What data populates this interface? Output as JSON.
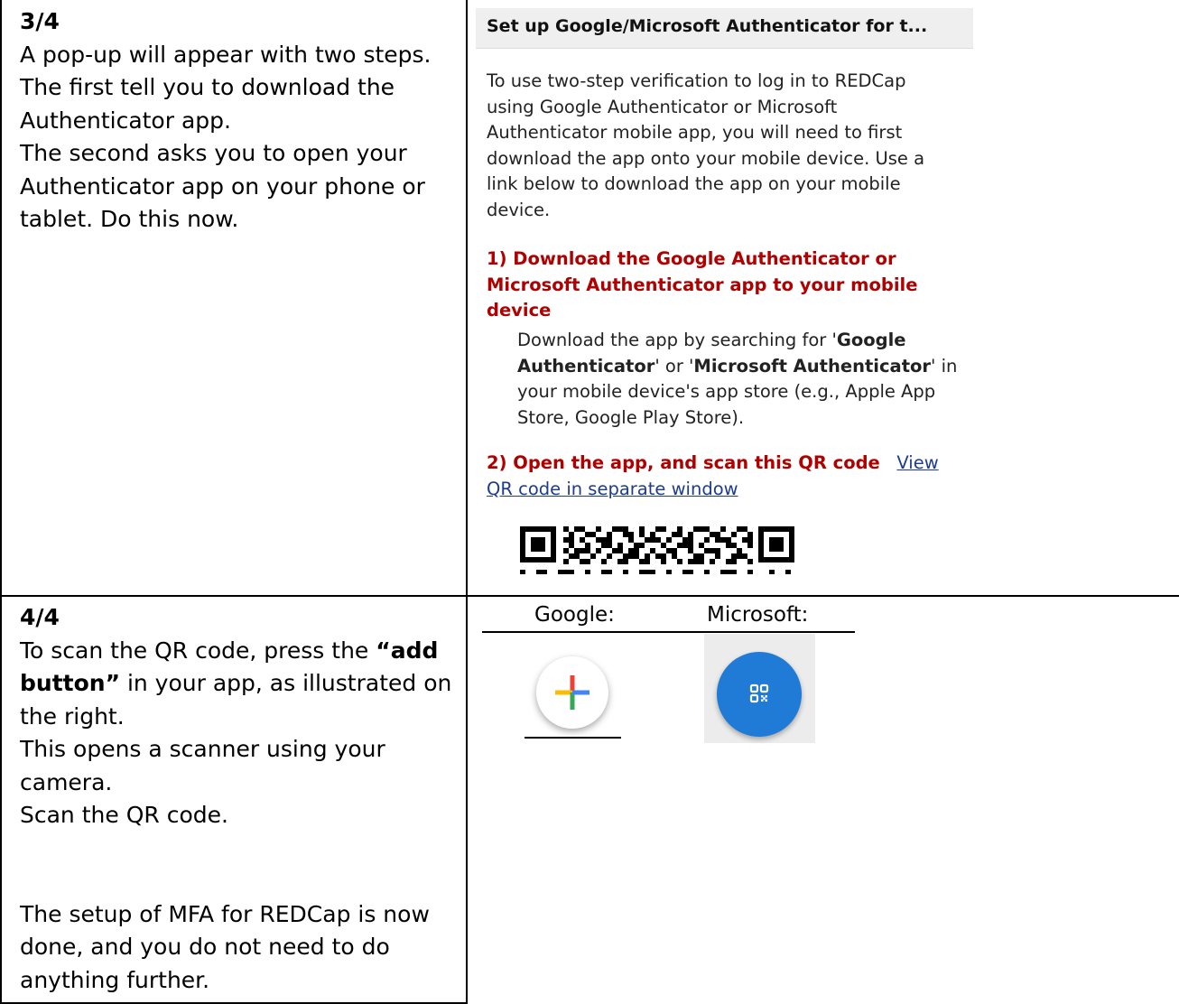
{
  "step3": {
    "label": "3/4",
    "lines": [
      "A pop-up will appear with two steps.",
      "The first tell you to download the",
      "Authenticator app.",
      "The second asks you to open your",
      "Authenticator app on your phone or",
      "tablet. Do this now."
    ]
  },
  "dialog": {
    "title": "Set up Google/Microsoft Authenticator for t...",
    "intro_lines": [
      "To use two-step verification to log in to REDCap",
      "using Google Authenticator or Microsoft",
      "Authenticator mobile app, you will need to first",
      "download the app onto your mobile device. Use a",
      "link below to download the app on your mobile",
      "device."
    ],
    "step1_lines": [
      "1) Download the Google Authenticator or",
      "Microsoft Authenticator app to your mobile",
      "device"
    ],
    "step1_desc": {
      "l1_a": "Download the app by searching for '",
      "l1_b": "Google",
      "l2_a": "Authenticator",
      "l2_b": "' or '",
      "l2_c": "Microsoft Authenticator",
      "l2_d": "' in",
      "l3": "your mobile device's app store (e.g., Apple App",
      "l4": "Store, Google Play Store)."
    },
    "step2_label": "2) Open the app, and scan this QR code",
    "qr_link_1": "View",
    "qr_link_2": "QR code in separate window"
  },
  "step4": {
    "label": "4/4",
    "l1": "To scan the QR code, press the ",
    "l1_bold": "“add",
    "l2_bold": "button”",
    "l2": " in your app, as illustrated on",
    "l3": "the right.",
    "l4": "This opens a scanner using your",
    "l5": "camera.",
    "l6": "Scan the QR code.",
    "l7": "The setup of MFA for REDCap is now",
    "l8": "done, and you do not need to do",
    "l9": "anything further."
  },
  "icons": {
    "google_label": "Google:",
    "microsoft_label": "Microsoft:",
    "google_icon": "plus-add-icon",
    "microsoft_icon": "qr-scan-icon"
  },
  "colors": {
    "redcap_red": "#b00000",
    "link_blue": "#1d3b8f",
    "ms_blue": "#1f7bd6",
    "google_blue": "#4285f4",
    "google_red": "#ea4335",
    "google_yellow": "#fbbc05",
    "google_green": "#34a853"
  }
}
